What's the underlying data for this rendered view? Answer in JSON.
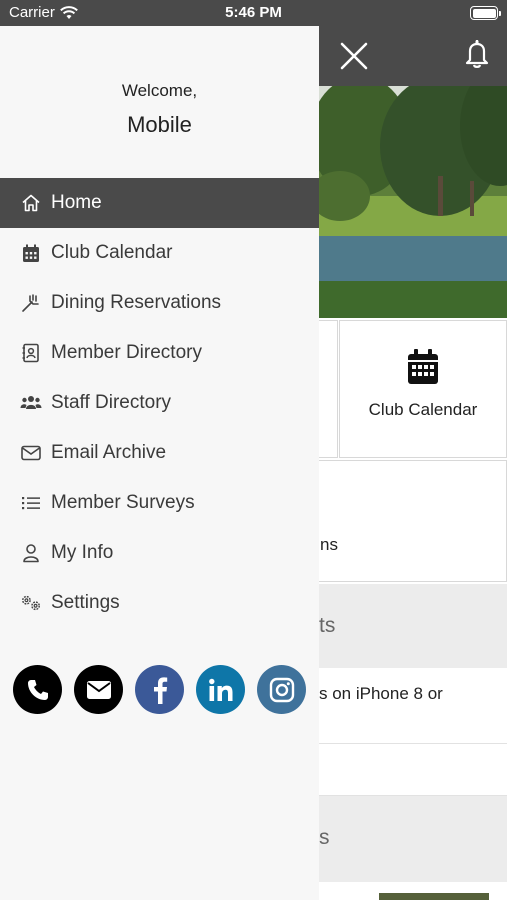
{
  "status": {
    "carrier": "Carrier",
    "time": "5:46 PM"
  },
  "drawer": {
    "greeting": "Welcome,",
    "user_name": "Mobile",
    "menu": [
      {
        "label": "Home",
        "icon": "home-icon",
        "active": true
      },
      {
        "label": "Club Calendar",
        "icon": "calendar-icon"
      },
      {
        "label": "Dining Reservations",
        "icon": "utensils-icon"
      },
      {
        "label": "Member Directory",
        "icon": "address-book-icon"
      },
      {
        "label": "Staff Directory",
        "icon": "users-icon"
      },
      {
        "label": "Email Archive",
        "icon": "envelope-icon"
      },
      {
        "label": "Member Surveys",
        "icon": "list-icon"
      },
      {
        "label": "My Info",
        "icon": "user-icon"
      },
      {
        "label": "Settings",
        "icon": "cogs-icon"
      }
    ],
    "social": [
      "phone-icon",
      "mail-icon",
      "facebook-icon",
      "linkedin-icon",
      "instagram-icon"
    ],
    "social_colors": {
      "phone": "#000000",
      "mail": "#000000",
      "facebook": "#3b5998",
      "linkedin": "#0e76a8",
      "instagram": "#3f729b"
    }
  },
  "main": {
    "tiles": {
      "club_calendar": "Club Calendar",
      "wide_fragment": "ns"
    },
    "sections": {
      "first_fragment": "ts",
      "second_fragment": "s"
    },
    "rows": {
      "first_fragment_line1": "s on iPhone 8 or"
    }
  },
  "colors": {
    "header": "#4a4a4a",
    "drawer_bg": "#f7f7f7",
    "section_bg": "#ececec"
  }
}
